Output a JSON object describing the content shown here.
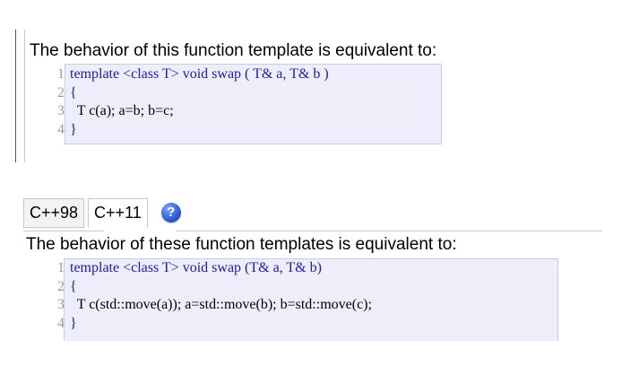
{
  "section1": {
    "intro": "The behavior of this function template is equivalent to:",
    "code": [
      {
        "num": "1",
        "parts": [
          {
            "t": "template <class T> void swap ( T& a, T& b )",
            "kw": true
          }
        ]
      },
      {
        "num": "2",
        "parts": [
          {
            "t": "{",
            "kw": true
          }
        ]
      },
      {
        "num": "3",
        "parts": [
          {
            "t": "  T c(a); a=b; b=c;",
            "kw": false
          }
        ]
      },
      {
        "num": "4",
        "parts": [
          {
            "t": "}",
            "kw": true
          }
        ]
      }
    ]
  },
  "tabs": {
    "items": [
      {
        "label": "C++98",
        "active": false
      },
      {
        "label": "C++11",
        "active": true
      }
    ],
    "help_icon": "question-mark-icon",
    "help_glyph": "?"
  },
  "section2": {
    "intro": "The behavior of these function templates is equivalent to:",
    "code": [
      {
        "num": "1",
        "parts": [
          {
            "t": "template <class T> void swap (T& a, T& b)",
            "kw": true
          }
        ]
      },
      {
        "num": "2",
        "parts": [
          {
            "t": "{",
            "kw": true
          }
        ]
      },
      {
        "num": "3",
        "parts": [
          {
            "t": "  T c(std::move(a)); a=std::move(b); b=std::move(c);",
            "kw": false
          }
        ]
      },
      {
        "num": "4",
        "parts": [
          {
            "t": "}",
            "kw": true
          }
        ]
      }
    ]
  },
  "colors": {
    "code_bg": "#eeeefb",
    "code_border": "#c9c9ea",
    "keyword": "#20209a",
    "line_number": "#9a9a9a"
  }
}
